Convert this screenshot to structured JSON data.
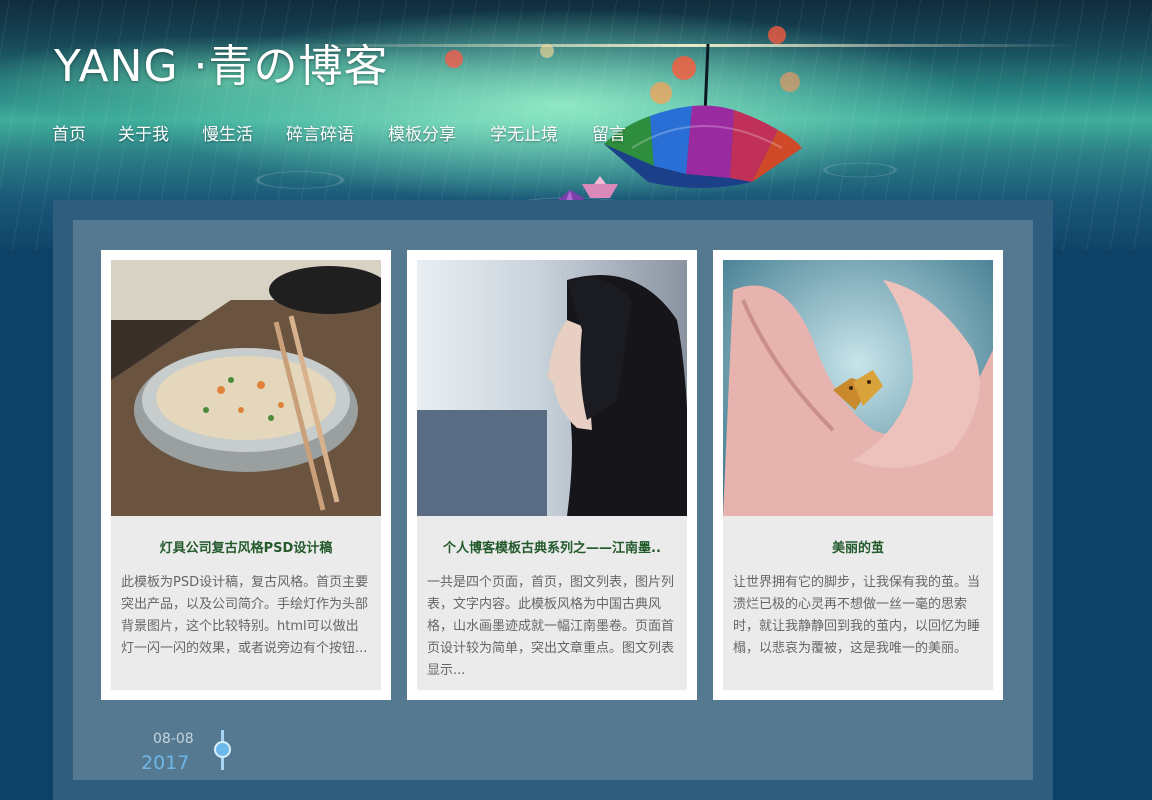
{
  "site": {
    "title": "YANG ·青の博客"
  },
  "nav": {
    "items": [
      {
        "label": "首页"
      },
      {
        "label": "关于我"
      },
      {
        "label": "慢生活"
      },
      {
        "label": "碎言碎语"
      },
      {
        "label": "模板分享"
      },
      {
        "label": "学无止境"
      },
      {
        "label": "留言"
      }
    ]
  },
  "cards": [
    {
      "title": "灯具公司复古风格PSD设计稿",
      "description": "此模板为PSD设计稿，复古风格。首页主要突出产品，以及公司简介。手绘灯作为头部背景图片，这个比较特别。html可以做出灯一闪一闪的效果，或者说旁边有个按钮...",
      "image": "bowl-of-rice-photo"
    },
    {
      "title": "个人博客模板古典系列之——江南墨..",
      "description": "一共是四个页面，首页，图文列表，图片列表，文字内容。此模板风格为中国古典风格，山水画墨迹成就一幅江南墨卷。页面首页设计较为简单，突出文章重点。图文列表显示...",
      "image": "woman-portrait-photo"
    },
    {
      "title": "美丽的茧",
      "description": "让世界拥有它的脚步，让我保有我的茧。当溃烂已极的心灵再不想做一丝一毫的思索时，就让我静静回到我的茧内，以回忆为睡榻，以悲哀为覆被，这是我唯一的美丽。",
      "image": "hands-with-butterfly-photo"
    }
  ],
  "timeline": {
    "date": "08-08",
    "year": "2017"
  },
  "colors": {
    "page_bg": "#0d4166",
    "outer_panel": "#2f5d7e",
    "inner_panel": "#557991",
    "card_title": "#235a2c",
    "card_text": "#666666",
    "timeline_year": "#6fb6e6"
  }
}
